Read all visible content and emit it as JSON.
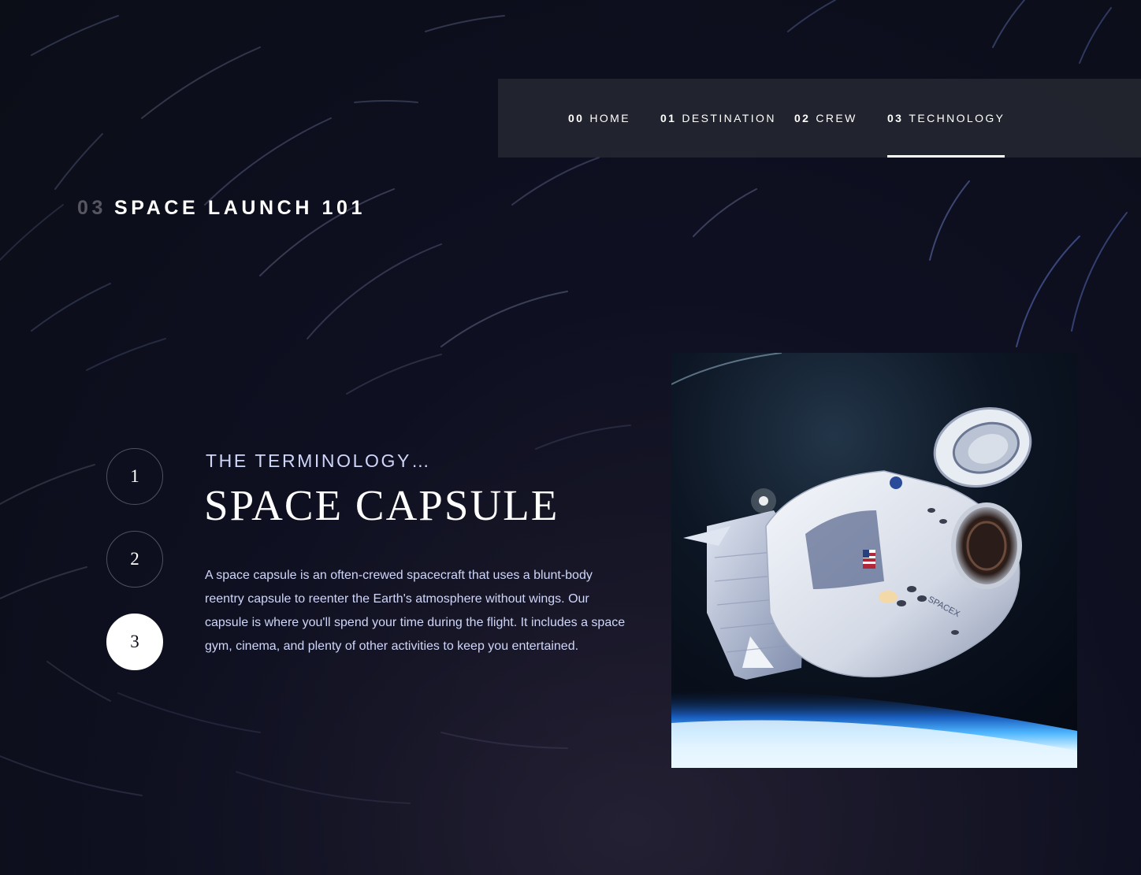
{
  "nav": {
    "items": [
      {
        "num": "00",
        "label": "HOME"
      },
      {
        "num": "01",
        "label": "DESTINATION"
      },
      {
        "num": "02",
        "label": "CREW"
      },
      {
        "num": "03",
        "label": "TECHNOLOGY"
      }
    ],
    "active_index": 3
  },
  "heading": {
    "num": "03",
    "label": "SPACE LAUNCH 101"
  },
  "steps": [
    "1",
    "2",
    "3"
  ],
  "active_step": "3",
  "content": {
    "subheading": "THE TERMINOLOGY…",
    "title": "SPACE CAPSULE",
    "description": "A space capsule is an often-crewed spacecraft that uses a blunt-body reentry capsule to reenter the Earth's atmosphere without wings. Our capsule is where you'll spend your time during the flight. It includes a space gym, cinema, and plenty of other activities to keep you entertained."
  },
  "icons": {
    "image": "space-capsule-image"
  },
  "colors": {
    "background": "#0b0d17",
    "accent_text": "#d0d6f9",
    "white": "#ffffff"
  }
}
